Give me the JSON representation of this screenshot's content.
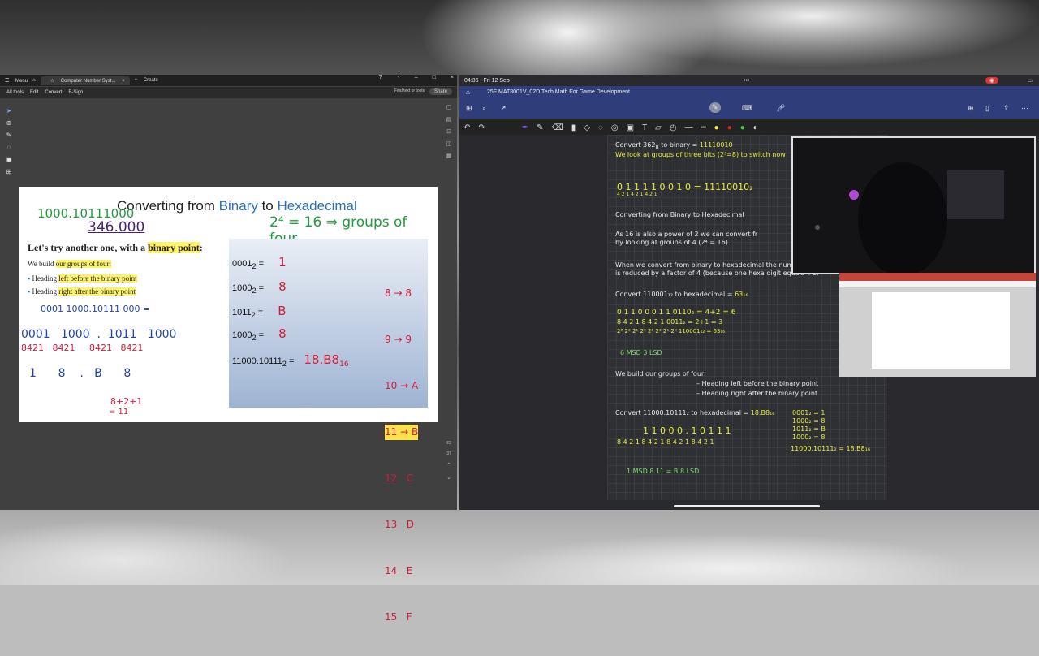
{
  "pdf": {
    "menu_label": "Menu",
    "tab_title": "Computer Number Syst...",
    "create_label": "Create",
    "menus": [
      "All tools",
      "Edit",
      "Convert",
      "E-Sign"
    ],
    "find_placeholder": "Find text or tools",
    "share_label": "Share",
    "page_numbers": [
      "23",
      "37"
    ],
    "slide": {
      "title_pre": "Converting from ",
      "title_bin": "Binary",
      "title_mid": " to ",
      "title_hex": "Hexadecimal",
      "lead_pre": "Let's try another one, with a ",
      "lead_hl": "binary point",
      "lead_post": ":",
      "build_pre": "We build ",
      "build_hl": "our groups of four:",
      "bullet1_pre": "Heading ",
      "bullet1_hl": "left before the binary point",
      "bullet2_pre": "Heading ",
      "bullet2_hl": "right after the binary point",
      "rows": [
        {
          "label": "0001",
          "sub": "2",
          "eq": " =",
          "hw": "1"
        },
        {
          "label": "1000",
          "sub": "2",
          "eq": " =",
          "hw": "8"
        },
        {
          "label": "1011",
          "sub": "2",
          "eq": " =",
          "hw": "B"
        },
        {
          "label": "1000",
          "sub": "2",
          "eq": " =",
          "hw": "8"
        },
        {
          "label": "11000.10111",
          "sub": "2",
          "eq": " =",
          "hw": "18.B8",
          "hw_sub": "16"
        }
      ],
      "hex_map": [
        "8 → 8",
        "9 → 9",
        "10 → A",
        "11 → B",
        "12   C",
        "13   D",
        "14   E",
        "15   F"
      ],
      "hw_top1": "1000.10111000",
      "hw_top2": "346.000",
      "hw_power": "2⁴ = 16  ⇒ groups of four",
      "hw_number": "0001 1000.10111 000 =",
      "hw_groups": "0001   1000  .  1011   1000",
      "hw_weights": "8421   8421     8421   8421",
      "hw_digits": "1      8    .   B      8",
      "hw_sum1": "8+2+1",
      "hw_sum2": "= 11"
    }
  },
  "ipad": {
    "time": "04:36",
    "date": "Fri 12 Sep",
    "doc_title": "25F MAT8001V_02D Tech Math For Game Development",
    "note_lines": [
      {
        "text": "Convert 362",
        "extra": "8",
        "rest": " to binary = ",
        "ans": "11110010"
      },
      {
        "text": "We look at groups of three bits (2³=8) to switch now"
      },
      {
        "text": "0 1 1    1 1 0    0 1 0    = 11110010₂"
      },
      {
        "text": "4 2 1    4 2 1    4 2 1"
      },
      {
        "text": "Converting from Binary to Hexadecimal"
      },
      {
        "text": "As 16 is also a power of 2 we can convert fr"
      },
      {
        "text": "by looking at groups of 4 (2⁴ = 16)."
      },
      {
        "text": "When we convert from binary to hexadecimal the number of digits"
      },
      {
        "text": "is reduced by a factor of 4 (because one hexa digit equals 4 bi"
      },
      {
        "text": "Convert 110001₁₂ to hexadecimal = ",
        "ans": "63₁₆"
      },
      {
        "text": "0 1 1 0    0 0 1 1     0110₂ = 4+2 = 6"
      },
      {
        "text": "8 4 2 1    8 4 2 1     0011₂ = 2+1 = 3"
      },
      {
        "text": "2³ 2² 2¹ 2⁰  2³ 2² 2¹ 2⁰   110001₁₂ = 63₁₆"
      },
      {
        "text": "6 MSD        3 LSD"
      },
      {
        "text": "We build our groups of four:"
      },
      {
        "text": "– Heading left before the binary point"
      },
      {
        "text": "– Heading right after the binary point"
      },
      {
        "text": "Convert 11000.10111₂ to hexadecimal = ",
        "ans": "18.B8₁₆"
      },
      {
        "text": "1 1 0 0 0 . 1 0 1 1 1"
      },
      {
        "text": "8 4 2 1 8 4 2 1   8 4 2 1 8 4 2 1"
      },
      {
        "text": "1 MSD     8      11 = B     8 LSD"
      },
      {
        "text": "0001₂ = 1"
      },
      {
        "text": "1000₂ = 8"
      },
      {
        "text": "1011₂ = B"
      },
      {
        "text": "1000₂ = 8"
      },
      {
        "text": "11000.10111₂ = 18.B8₁₆"
      }
    ]
  }
}
